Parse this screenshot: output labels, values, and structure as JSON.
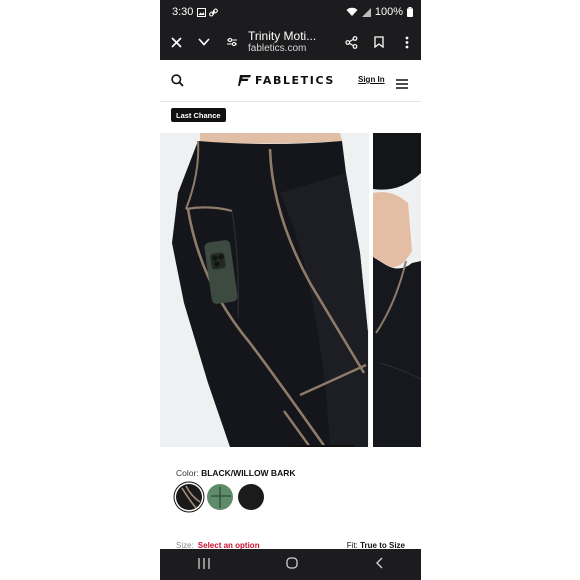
{
  "status": {
    "time": "3:30",
    "battery": "100%"
  },
  "browser": {
    "title": "Trinity Moti...",
    "url": "fabletics.com"
  },
  "site": {
    "brand": "FABLETICS",
    "sign_in": "Sign In"
  },
  "badge": "Last Chance",
  "product": {
    "color_label": "Color:",
    "color_value": "BLACK/WILLOW BARK",
    "swatches": [
      {
        "name": "black-willow-bark",
        "color": "#1a1a1a",
        "accent": "#a38f7c"
      },
      {
        "name": "sage-green",
        "color": "#5e8c6a",
        "accent": "#2f4d37"
      },
      {
        "name": "black",
        "color": "#1b1b1b",
        "accent": "#1b1b1b"
      }
    ],
    "size_label": "Size:",
    "size_select": "Select an option",
    "fit_label": "Fit:",
    "fit_value": "True to Size"
  },
  "icons": [
    "close-icon",
    "chevron-down-icon",
    "page-settings-icon",
    "share-icon",
    "bookmark-icon",
    "more-vert-icon",
    "search-icon",
    "menu-icon",
    "recents-icon",
    "home-icon",
    "back-icon"
  ]
}
